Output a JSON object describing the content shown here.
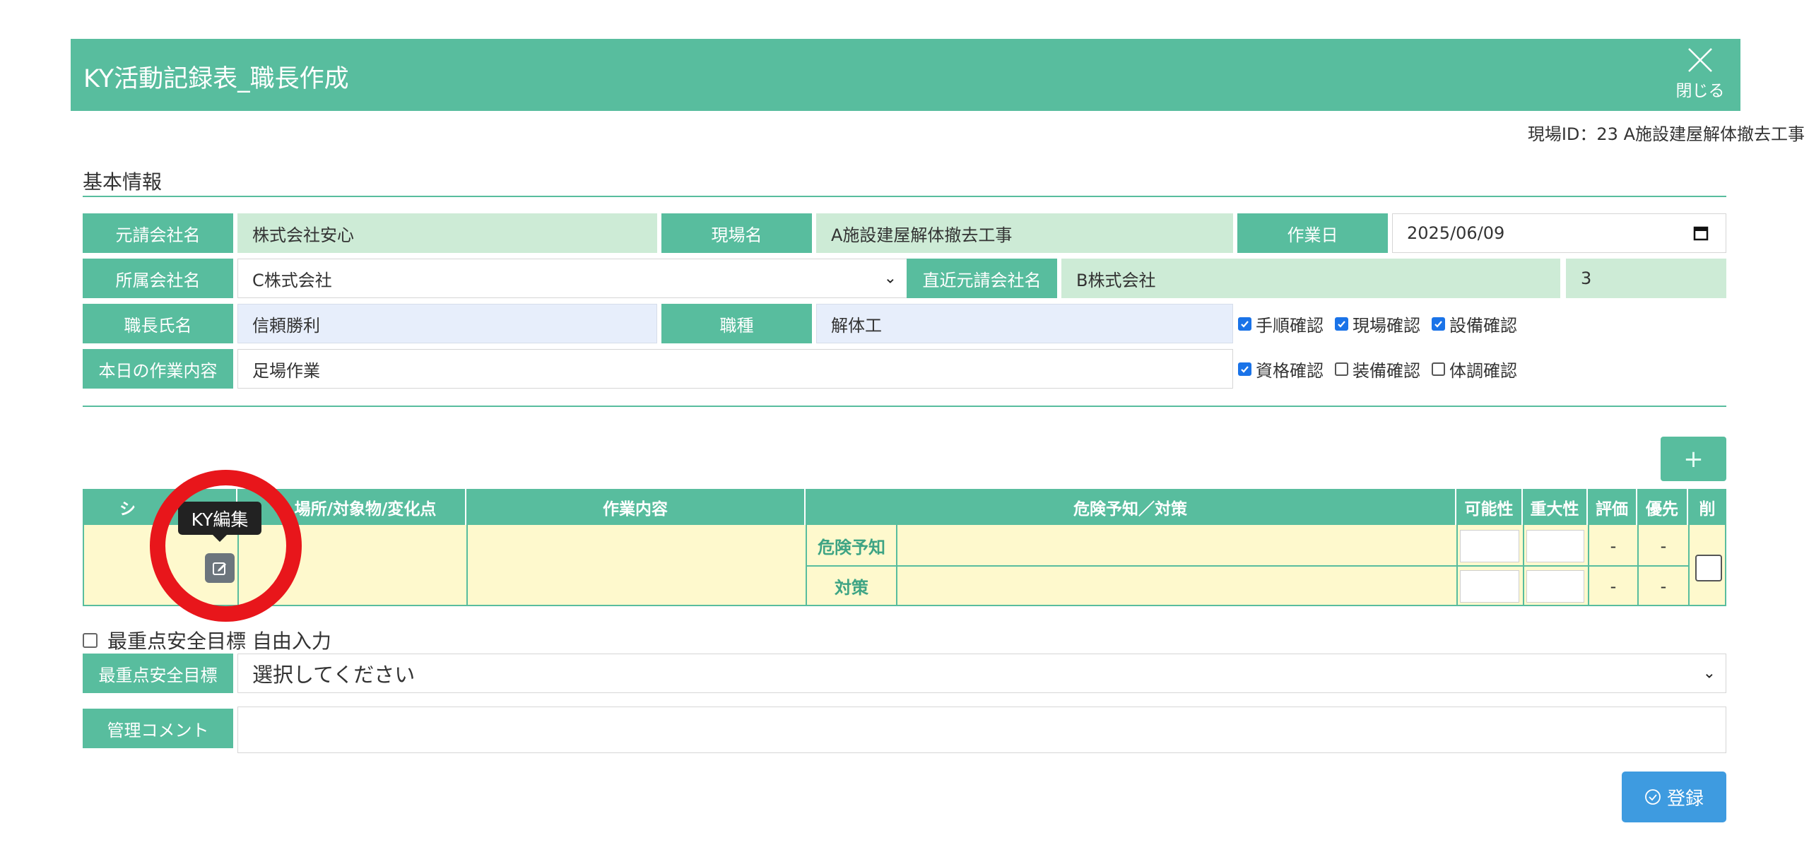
{
  "header": {
    "title": "KY活動記録表_職長作成",
    "close_label": "閉じる"
  },
  "site_id_text": "現場ID：23 A施設建屋解体撤去工事",
  "basic_info": {
    "section_title": "基本情報",
    "prime_contractor_label": "元請会社名",
    "prime_contractor_value": "株式会社安心",
    "site_name_label": "現場名",
    "site_name_value": "A施設建屋解体撤去工事",
    "work_date_label": "作業日",
    "work_date_value": "2025/06/09",
    "affiliated_company_label": "所属会社名",
    "affiliated_company_value": "C株式会社",
    "direct_prime_label": "直近元請会社名",
    "direct_prime_value": "B株式会社",
    "tier_value": "3",
    "foreman_label": "職長氏名",
    "foreman_value": "信頼勝利",
    "trade_label": "職種",
    "trade_value": "解体工",
    "today_work_label": "本日の作業内容",
    "today_work_value": "足場作業"
  },
  "checks": [
    {
      "label": "手順確認",
      "checked": true
    },
    {
      "label": "現場確認",
      "checked": true
    },
    {
      "label": "設備確認",
      "checked": true
    },
    {
      "label": "資格確認",
      "checked": true
    },
    {
      "label": "装備確認",
      "checked": false
    },
    {
      "label": "体調確認",
      "checked": false
    }
  ],
  "add_button_label": "+",
  "ky_table": {
    "headers": {
      "scene": "シ",
      "place": "場所/対象物/変化点",
      "work": "作業内容",
      "hazard": "危険予知／対策",
      "possibility": "可能性",
      "severity": "重大性",
      "evaluation": "評価",
      "priority": "優先",
      "delete": "削"
    },
    "row": {
      "hazard_label": "危険予知",
      "measure_label": "対策",
      "hazard_eval": "-",
      "hazard_priority": "-",
      "measure_eval": "-",
      "measure_priority": "-"
    }
  },
  "tooltip": "KY編集",
  "free_input_label": "最重点安全目標 自由入力",
  "safety_goal": {
    "label": "最重点安全目標",
    "value": "選択してください"
  },
  "management_comment": {
    "label": "管理コメント",
    "value": ""
  },
  "register_button_label": "登録",
  "colors": {
    "primary_green": "#58bd9e",
    "light_green": "#cdebd6",
    "light_blue": "#e7eefb",
    "yellow_row": "#fef9cd",
    "button_blue": "#3e9be0",
    "annotation_red": "#e8161b"
  }
}
